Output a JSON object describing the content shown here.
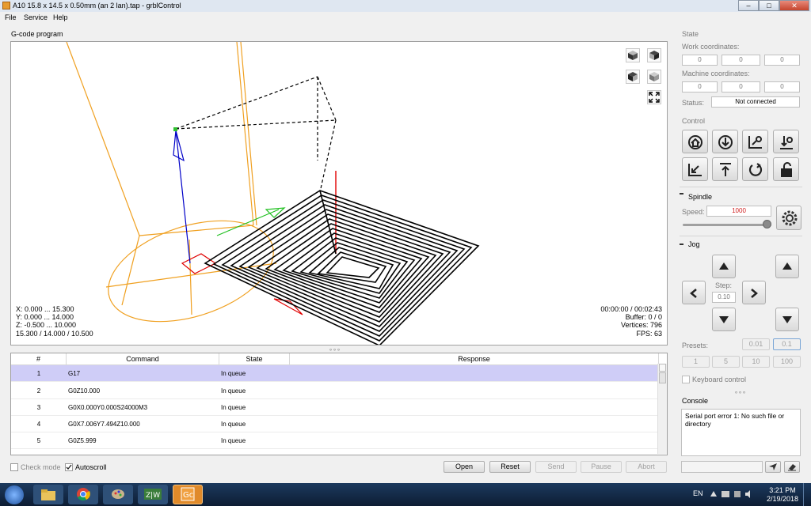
{
  "window": {
    "title": "A10 15.8 x 14.5 x 0.50mm (an 2 lan).tap - grblControl",
    "min": "–",
    "max": "□",
    "close": "✕"
  },
  "menu": {
    "file": "File",
    "service": "Service",
    "help": "Help"
  },
  "gcode_group": {
    "title": "G-code program"
  },
  "viewport": {
    "bounds_x": "X: 0.000 ... 15.300",
    "bounds_y": "Y: 0.000 ... 14.000",
    "bounds_z": "Z: -0.500 ... 10.000",
    "size": "15.300 / 14.000 / 10.500",
    "time": "00:00:00 / 00:02:43",
    "buffer": "Buffer: 0 / 0",
    "vertices": "Vertices: 796",
    "fps": "FPS: 63",
    "icons": [
      "cube-top-view-icon",
      "cube-front-view-icon",
      "cube-left-view-icon",
      "cube-iso-view-icon",
      "fit-view-icon"
    ]
  },
  "splitter": "∘∘∘",
  "table": {
    "headers": [
      "#",
      "Command",
      "State",
      "Response"
    ],
    "rows": [
      {
        "num": "1",
        "cmd": "G17",
        "state": "In queue",
        "resp": ""
      },
      {
        "num": "2",
        "cmd": "G0Z10.000",
        "state": "In queue",
        "resp": ""
      },
      {
        "num": "3",
        "cmd": "G0X0.000Y0.000S24000M3",
        "state": "In queue",
        "resp": ""
      },
      {
        "num": "4",
        "cmd": "G0X7.006Y7.494Z10.000",
        "state": "In queue",
        "resp": ""
      },
      {
        "num": "5",
        "cmd": "G0Z5.999",
        "state": "In queue",
        "resp": ""
      }
    ]
  },
  "bottom": {
    "check_mode": "Check mode",
    "autoscroll": "Autoscroll",
    "open": "Open",
    "reset": "Reset",
    "send": "Send",
    "pause": "Pause",
    "abort": "Abort"
  },
  "state": {
    "title": "State",
    "work_label": "Work coordinates:",
    "work": [
      "0",
      "0",
      "0"
    ],
    "machine_label": "Machine coordinates:",
    "machine": [
      "0",
      "0",
      "0"
    ],
    "status_label": "Status:",
    "status": "Not connected"
  },
  "control": {
    "title": "Control",
    "icons": [
      "home-icon",
      "probe-icon",
      "zero-xy-icon",
      "zero-z-icon",
      "restore-origin-icon",
      "safe-position-icon",
      "reset-icon",
      "unlock-icon"
    ]
  },
  "spindle": {
    "title": "Spindle",
    "speed_label": "Speed:",
    "speed": "1000",
    "slider_fraction": 1.0
  },
  "jog": {
    "title": "Jog",
    "step_label": "Step:",
    "step": "0.10",
    "presets_label": "Presets:",
    "presets_row1": [
      "0.01",
      "0.1"
    ],
    "presets_row2": [
      "1",
      "5",
      "10",
      "100"
    ],
    "keyboard_control": "Keyboard control"
  },
  "console": {
    "title": "Console",
    "text": "Serial port error 1: No such file or directory"
  },
  "taskbar": {
    "lang": "EN",
    "time": "3:21 PM",
    "date": "2/19/2018"
  },
  "colors": {
    "selected_row": "#cfcdf7",
    "speed_text": "#d02020",
    "toolpath": "#000000",
    "tool_outline": "#f0a020"
  }
}
